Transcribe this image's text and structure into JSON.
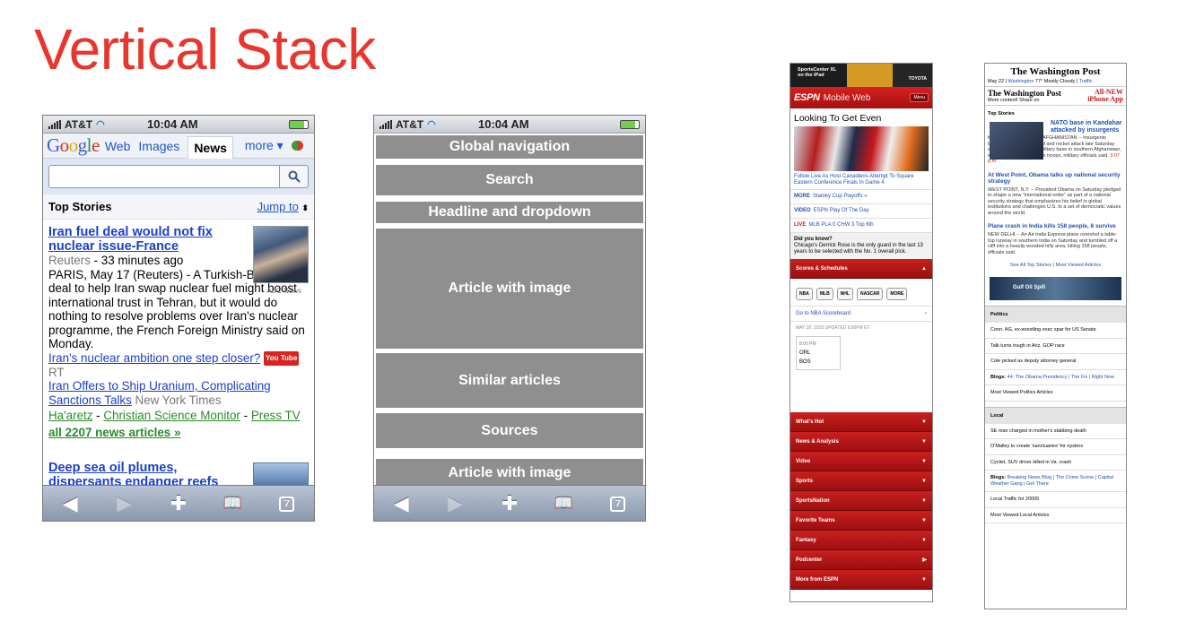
{
  "slide": {
    "title": "Vertical Stack"
  },
  "status_bar": {
    "carrier": "AT&T",
    "time": "10:04 AM"
  },
  "google": {
    "logo": "Google",
    "tabs": {
      "web": "Web",
      "images": "Images",
      "news": "News",
      "more": "more ▾"
    },
    "search_placeholder": "",
    "top_stories": "Top Stories",
    "jump_to": "Jump to",
    "article1": {
      "headline": "Iran fuel deal would not fix nuclear issue-France",
      "source": "Reuters",
      "age": " - 33 minutes ago",
      "body": "PARIS, May 17 (Reuters) - A Turkish-Brazilian deal to help Iran swap nuclear fuel might boost international trust in Tehran, but it would do nothing to resolve problems over Iran's nuclear programme, the French Foreign Ministry said on Monday.",
      "image_caption": "ABC News",
      "related1": "Iran's nuclear ambition one step closer?",
      "related1_src": "RT",
      "related2": "Iran Offers to Ship Uranium, Complicating Sanctions Talks",
      "related2_src": " New York Times",
      "src_a": "Ha'aretz",
      "src_b": "Christian Science Monitor",
      "src_c": "Press TV",
      "all_articles": "all 2207 news articles »",
      "youtube": "You Tube"
    },
    "article2": {
      "headline": "Deep sea oil plumes, dispersants endanger reefs"
    }
  },
  "wireframe": {
    "blocks": [
      "Global navigation",
      "Search",
      "Headline and dropdown",
      "Article with image",
      "Similar articles",
      "Sources",
      "Article with image"
    ]
  },
  "espn": {
    "ad_text": "SportsCenter XL on the iPad",
    "ad_brand": "TOYOTA",
    "logo": "ESPN",
    "mobile_web": "Mobile Web",
    "menu": "Menu",
    "feature_title": "Looking To Get Even",
    "feature_caption": "Follow Live As Host Canadiens Attempt To Square Eastern Conference Finals In Game 4",
    "rows": [
      {
        "tag": "MORE",
        "text": "Stanley Cup Playoffs »"
      },
      {
        "tag": "VIDEO",
        "text": "ESPN Play Of The Day"
      },
      {
        "tag": "LIVE",
        "text": "MLB PLA 0 CHW 3 Top 6th"
      }
    ],
    "know_title": "Did you know?",
    "know_text": "Chicago's Derrick Rose is the only guard in the last 13 years to be selected with the No. 1 overall pick.",
    "scores_bar": "Scores & Schedules",
    "pills": [
      "NBA",
      "MLB",
      "NHL",
      "NASCAR",
      "MORE"
    ],
    "scoreboard_link": "Go to NBA Scoreboard",
    "date": "MAY 20, 2010 UPDATED 9:00PM ET",
    "game_time": "8:00 PM",
    "team1": "ORL",
    "team2": "BOS",
    "sections": [
      "What's Hot",
      "News & Analysis",
      "Video",
      "Sports",
      "SportsNation",
      "Favorite Teams",
      "Fantasy",
      "Podcenter",
      "More from ESPN"
    ]
  },
  "wapo": {
    "masthead": "The Washington Post",
    "meta_date": "May 22 | ",
    "meta_city": "Washington",
    "meta_weather": " 77° Mostly Cloudy | ",
    "meta_traffic": "Traffic",
    "mast2_title": "The Washington Post",
    "mast2_sub": "More content! Share on",
    "new_app": "All-NEW iPhone App",
    "top_stories": "Top Stories",
    "lead_headline": "NATO base in Kandahar attacked by insurgents",
    "lead_body": "KANDAHAR AIR FIELD, AFGHANISTAN -- Insurgents launched a brazen ground and rocket attack late Saturday against NATO's largest military base in southern Afghanistan, wounding several coalition troops, military officials said.",
    "lead_time": "3:07 p.m.",
    "story2_headline": "At West Point, Obama talks up national security strategy",
    "story2_body": "WEST POINT, N.Y. -- President Obama on Saturday pledged to shape a new \"international order\" as part of a national security strategy that emphasizes his belief in global institutions and challenges U.S. to a set of democratic values around the world.",
    "story3_headline": "Plane crash in India kills 158 people, 8 survive",
    "story3_body": "NEW DELHI -- An Air India Express plane overshot a table-top runway in southern India on Saturday and tumbled off a cliff into a heavily wooded hilly area, killing 158 people, officials said.",
    "see_all": "See All Top Stories | Most Viewed Articles",
    "banner": "Gulf Oil Spill",
    "politics": "Politics",
    "politics_items": [
      "Conn. AG, ex-wrestling exec spar for US Senate",
      "Talk turns tough in Ariz. GOP race",
      "Cole picked as deputy attorney general"
    ],
    "politics_blogs_label": "Blogs:",
    "politics_blogs": "44: The Obama Presidency | The Fix | Right Now",
    "politics_more": "Most Viewed Politics Articles",
    "local": "Local",
    "local_items": [
      "SE man charged in mother's stabbing death",
      "O'Malley to create 'sanctuaries' for oysters",
      "Cyclist, SUV driver killed in Va. crash"
    ],
    "local_blogs_label": "Blogs:",
    "local_blogs": "Breaking News Blog | The Crime Scene | Capital Weather Gang | Get There",
    "local_traffic": "Local Traffic for 20005",
    "local_more": "Most Viewed Local Articles"
  }
}
